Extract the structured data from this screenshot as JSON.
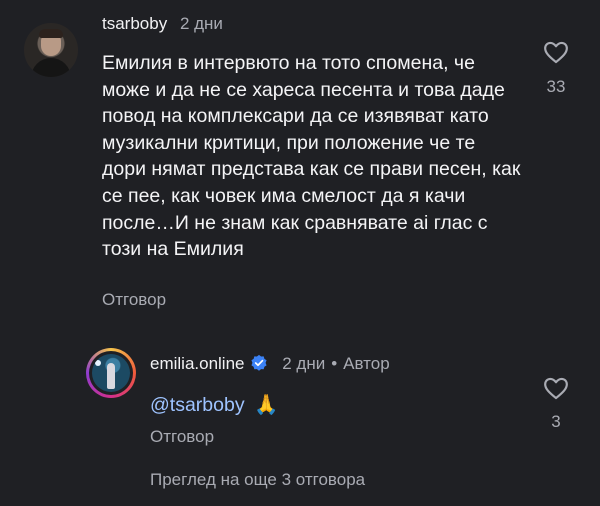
{
  "comment": {
    "username": "tsarboby",
    "time": "2 дни",
    "text": "Емилия в интервюто на тото спомена, че може и да не се хареса песента  и това даде повод на комплексари да се изявяват като музикални критици, при положение че те дори нямат представа как се прави песен, как се пее, как човек има смелост да я качи после…И не знам как сравнявате ai глас с този на Емилия",
    "reply_label": "Отговор",
    "likes": "33"
  },
  "reply": {
    "username": "emilia.online",
    "time": "2 дни",
    "author_label": "Автор",
    "mention": "@tsarboby",
    "emoji": "🙏",
    "reply_label": "Отговор",
    "likes": "3"
  },
  "view_more": "Преглед на още 3 отговора",
  "colors": {
    "background": "#1f2024",
    "secondary_text": "#a9abb3",
    "mention": "#9ec3ff",
    "verified": "#3b82f6"
  },
  "icons": {
    "like": "heart-outline-icon",
    "verified": "verified-badge-icon"
  }
}
